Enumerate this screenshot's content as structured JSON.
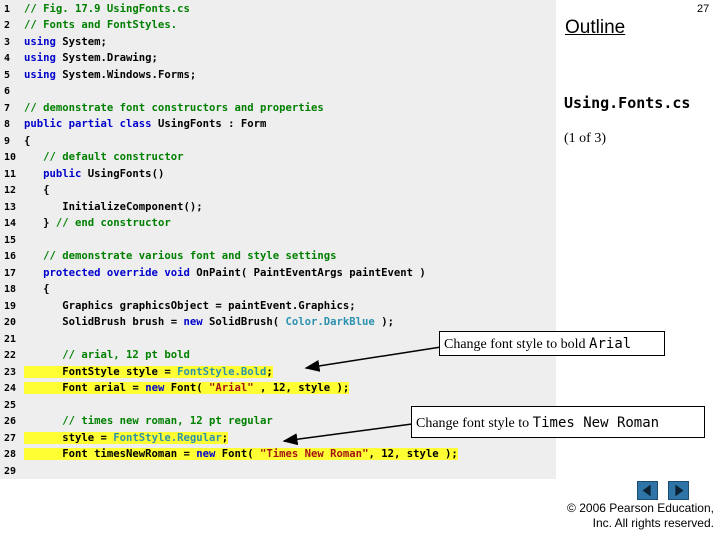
{
  "header": {
    "page_number": "27",
    "outline_title": "Outline",
    "file_name": "Using.Fonts.cs",
    "page_count": "(1 of 3)"
  },
  "code": {
    "lines": [
      {
        "n": "1",
        "hl": false,
        "segs": [
          {
            "c": "c",
            "t": "// Fig. 17.9 UsingFonts.cs"
          }
        ]
      },
      {
        "n": "2",
        "hl": false,
        "segs": [
          {
            "c": "c",
            "t": "// Fonts and FontStyles."
          }
        ]
      },
      {
        "n": "3",
        "hl": false,
        "segs": [
          {
            "c": "k",
            "t": "using"
          },
          {
            "c": "",
            "t": " System;"
          }
        ]
      },
      {
        "n": "4",
        "hl": false,
        "segs": [
          {
            "c": "k",
            "t": "using"
          },
          {
            "c": "",
            "t": " System.Drawing;"
          }
        ]
      },
      {
        "n": "5",
        "hl": false,
        "segs": [
          {
            "c": "k",
            "t": "using"
          },
          {
            "c": "",
            "t": " System.Windows.Forms;"
          }
        ]
      },
      {
        "n": "6",
        "hl": false,
        "segs": []
      },
      {
        "n": "7",
        "hl": false,
        "segs": [
          {
            "c": "c",
            "t": "// demonstrate font constructors and properties"
          }
        ]
      },
      {
        "n": "8",
        "hl": false,
        "segs": [
          {
            "c": "k",
            "t": "public partial class"
          },
          {
            "c": "",
            "t": " UsingFonts : Form"
          }
        ]
      },
      {
        "n": "9",
        "hl": false,
        "segs": [
          {
            "c": "",
            "t": "{"
          }
        ]
      },
      {
        "n": "10",
        "hl": false,
        "segs": [
          {
            "c": "c",
            "t": "   // default constructor"
          }
        ]
      },
      {
        "n": "11",
        "hl": false,
        "segs": [
          {
            "c": "k",
            "t": "   public"
          },
          {
            "c": "",
            "t": " UsingFonts()"
          }
        ]
      },
      {
        "n": "12",
        "hl": false,
        "segs": [
          {
            "c": "",
            "t": "   {"
          }
        ]
      },
      {
        "n": "13",
        "hl": false,
        "segs": [
          {
            "c": "",
            "t": "      InitializeComponent();"
          }
        ]
      },
      {
        "n": "14",
        "hl": false,
        "segs": [
          {
            "c": "",
            "t": "   } "
          },
          {
            "c": "c",
            "t": "// end constructor"
          }
        ]
      },
      {
        "n": "15",
        "hl": false,
        "segs": []
      },
      {
        "n": "16",
        "hl": false,
        "segs": [
          {
            "c": "c",
            "t": "   // demonstrate various font and style settings"
          }
        ]
      },
      {
        "n": "17",
        "hl": false,
        "segs": [
          {
            "c": "k",
            "t": "   protected override void"
          },
          {
            "c": "",
            "t": " OnPaint( PaintEventArgs paintEvent )"
          }
        ]
      },
      {
        "n": "18",
        "hl": false,
        "segs": [
          {
            "c": "",
            "t": "   {"
          }
        ]
      },
      {
        "n": "19",
        "hl": false,
        "segs": [
          {
            "c": "",
            "t": "      Graphics graphicsObject = paintEvent.Graphics;"
          }
        ]
      },
      {
        "n": "20",
        "hl": false,
        "segs": [
          {
            "c": "",
            "t": "      SolidBrush brush = "
          },
          {
            "c": "k",
            "t": "new"
          },
          {
            "c": "",
            "t": " SolidBrush( "
          },
          {
            "c": "t",
            "t": "Color.DarkBlue"
          },
          {
            "c": "",
            "t": " );"
          }
        ]
      },
      {
        "n": "21",
        "hl": false,
        "segs": []
      },
      {
        "n": "22",
        "hl": false,
        "segs": [
          {
            "c": "c",
            "t": "      // arial, 12 pt bold"
          }
        ]
      },
      {
        "n": "23",
        "hl": true,
        "segs": [
          {
            "c": "",
            "t": "      FontStyle style = "
          },
          {
            "c": "t",
            "t": "FontStyle.Bold"
          },
          {
            "c": "",
            "t": ";"
          }
        ]
      },
      {
        "n": "24",
        "hl": true,
        "segs": [
          {
            "c": "",
            "t": "      Font arial = "
          },
          {
            "c": "k",
            "t": "new"
          },
          {
            "c": "",
            "t": " Font( "
          },
          {
            "c": "s",
            "t": "\"Arial\""
          },
          {
            "c": "",
            "t": " , 12, style );"
          }
        ]
      },
      {
        "n": "25",
        "hl": false,
        "segs": []
      },
      {
        "n": "26",
        "hl": false,
        "segs": [
          {
            "c": "c",
            "t": "      // times new roman, 12 pt regular"
          }
        ]
      },
      {
        "n": "27",
        "hl": true,
        "segs": [
          {
            "c": "",
            "t": "      style = "
          },
          {
            "c": "t",
            "t": "FontStyle.Regular"
          },
          {
            "c": "",
            "t": ";"
          }
        ]
      },
      {
        "n": "28",
        "hl": true,
        "segs": [
          {
            "c": "",
            "t": "      Font timesNewRoman = "
          },
          {
            "c": "k",
            "t": "new"
          },
          {
            "c": "",
            "t": " Font( "
          },
          {
            "c": "s",
            "t": "\"Times New Roman\""
          },
          {
            "c": "",
            "t": ", 12, style );"
          }
        ]
      },
      {
        "n": "29",
        "hl": false,
        "segs": []
      }
    ]
  },
  "callouts": [
    {
      "prefix": "Change font style to bold ",
      "mono": "Arial"
    },
    {
      "prefix": "Change font style to ",
      "mono": "Times New Roman"
    }
  ],
  "nav": {
    "prev_icon": "left-triangle-icon",
    "next_icon": "right-triangle-icon"
  },
  "footer": {
    "copyright_line1": "© 2006 Pearson Education,",
    "copyright_line2": "Inc. All rights reserved."
  },
  "colors": {
    "panel_bg": "#eeeeee",
    "highlight": "#ffff33",
    "comment": "#008000",
    "keyword": "#0000cc",
    "nav_button": "#2e74a6"
  }
}
